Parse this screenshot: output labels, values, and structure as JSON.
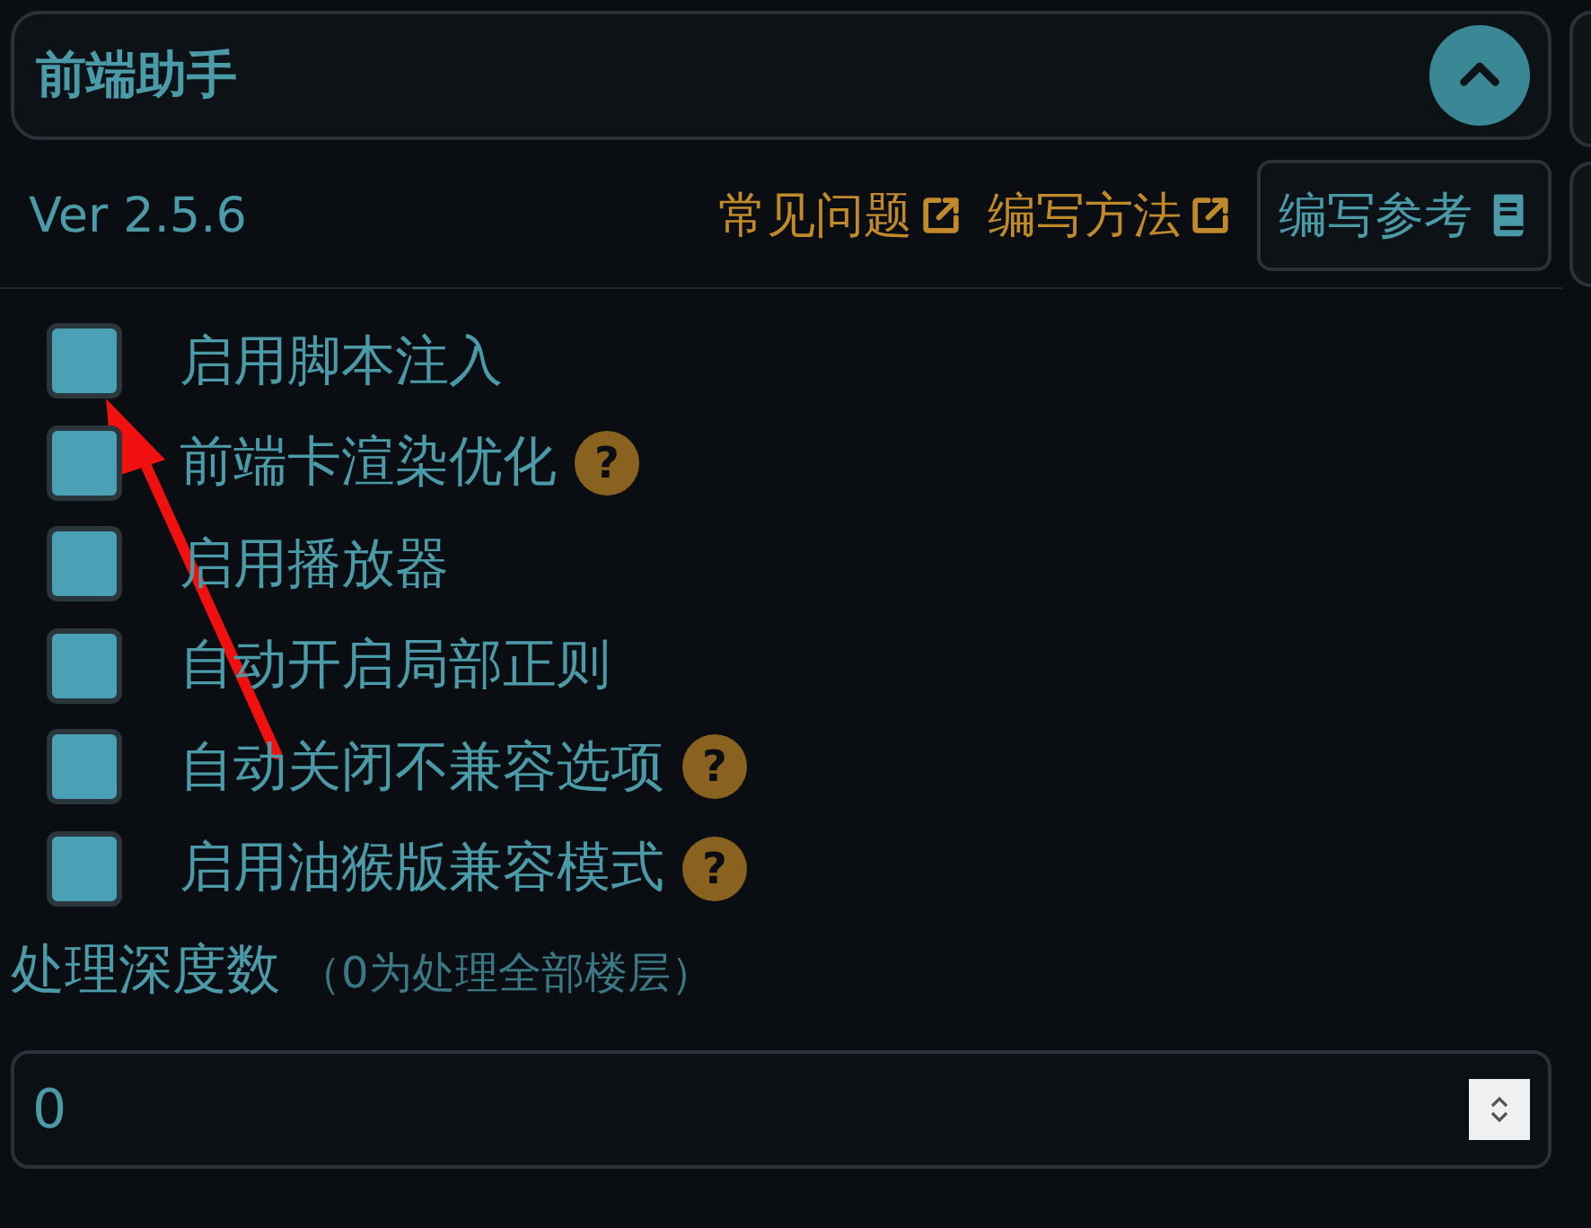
{
  "header": {
    "title": "前端助手",
    "expanded": true
  },
  "version": "Ver 2.5.6",
  "links": [
    {
      "label": "常见问题"
    },
    {
      "label": "编写方法"
    }
  ],
  "reference_button": {
    "label": "编写参考"
  },
  "options": [
    {
      "label": "启用脚本注入",
      "checked": false,
      "help": false
    },
    {
      "label": "前端卡渲染优化",
      "checked": false,
      "help": true
    },
    {
      "label": "启用播放器",
      "checked": false,
      "help": false
    },
    {
      "label": "自动开启局部正则",
      "checked": false,
      "help": false
    },
    {
      "label": "自动关闭不兼容选项",
      "checked": false,
      "help": true
    },
    {
      "label": "启用油猴版兼容模式",
      "checked": false,
      "help": true
    }
  ],
  "depth": {
    "label": "处理深度数",
    "hint": "（0为处理全部楼层）",
    "value": "0"
  },
  "help_mark": "?"
}
